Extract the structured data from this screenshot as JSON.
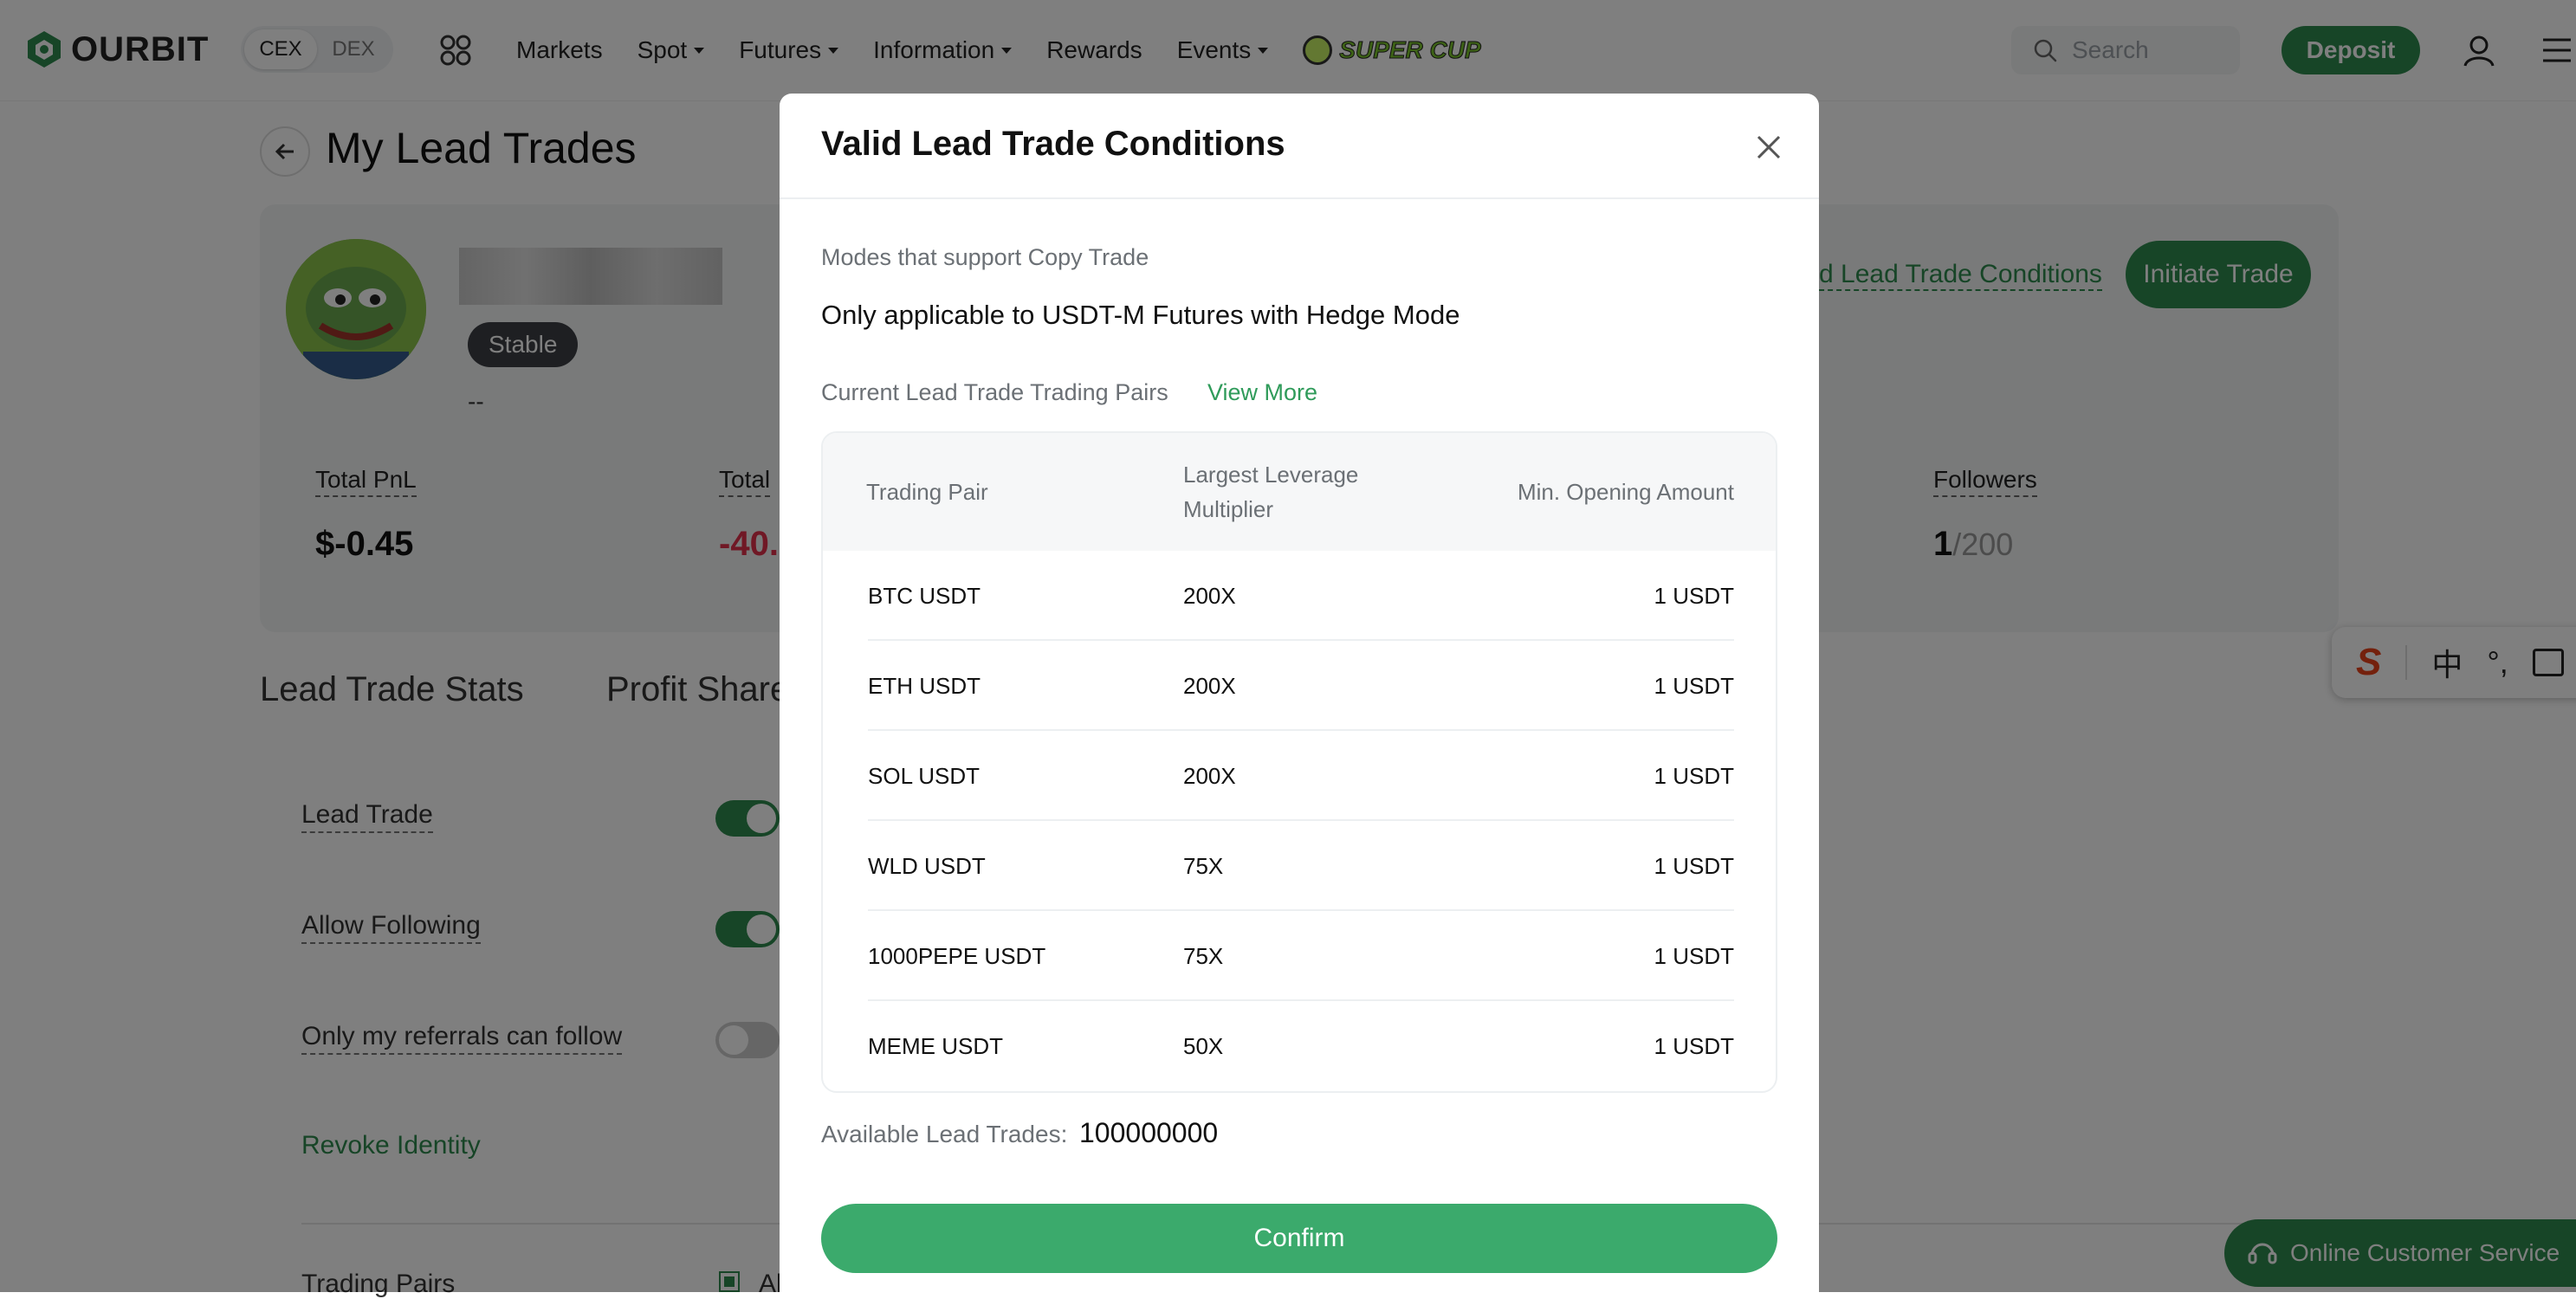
{
  "header": {
    "logo_text": "OURBIT",
    "segments": [
      "CEX",
      "DEX"
    ],
    "nav": [
      {
        "label": "Markets",
        "dropdown": false
      },
      {
        "label": "Spot",
        "dropdown": true
      },
      {
        "label": "Futures",
        "dropdown": true
      },
      {
        "label": "Information",
        "dropdown": true
      },
      {
        "label": "Rewards",
        "dropdown": false
      },
      {
        "label": "Events",
        "dropdown": true
      }
    ],
    "supercup": "SUPER CUP",
    "search_placeholder": "Search",
    "deposit_label": "Deposit"
  },
  "page": {
    "title": "My Lead Trades",
    "profile": {
      "badge": "Stable",
      "bio": "--",
      "conditions_link": "alid Lead Trade Conditions",
      "initiate_label": "Initiate Trade"
    },
    "stats": {
      "total_pnl_label": "Total PnL",
      "total_pnl_value": "$-0.45",
      "total_roi_label": "Total",
      "total_roi_value": "-40.",
      "followers_label": "Followers",
      "followers_value": "1",
      "followers_max": "/200"
    },
    "tabs": [
      "Lead Trade Stats",
      "Profit Share"
    ],
    "settings": [
      {
        "label": "Lead Trade",
        "on": true
      },
      {
        "label": "Allow Following",
        "on": true
      },
      {
        "label": "Only my referrals can follow",
        "on": false
      }
    ],
    "revoke_label": "Revoke Identity",
    "trading_pairs_label": "Trading Pairs",
    "trading_pairs_all": "Al"
  },
  "ime": {
    "logo": "S",
    "lang": "中",
    "punct": "°,"
  },
  "support_label": "Online Customer Service",
  "modal": {
    "title": "Valid Lead Trade Conditions",
    "modes_label": "Modes that support Copy Trade",
    "modes_value": "Only applicable to USDT-M Futures with Hedge Mode",
    "pairs_label": "Current Lead Trade Trading Pairs",
    "view_more": "View More",
    "table_headers": {
      "pair": "Trading Pair",
      "leverage_line1": "Largest Leverage",
      "leverage_line2": "Multiplier",
      "min_amount": "Min. Opening Amount"
    },
    "rows": [
      {
        "pair": "BTC USDT",
        "leverage": "200X",
        "min": "1 USDT"
      },
      {
        "pair": "ETH USDT",
        "leverage": "200X",
        "min": "1 USDT"
      },
      {
        "pair": "SOL USDT",
        "leverage": "200X",
        "min": "1 USDT"
      },
      {
        "pair": "WLD USDT",
        "leverage": "75X",
        "min": "1 USDT"
      },
      {
        "pair": "1000PEPE USDT",
        "leverage": "75X",
        "min": "1 USDT"
      },
      {
        "pair": "MEME USDT",
        "leverage": "50X",
        "min": "1 USDT"
      }
    ],
    "available_label": "Available Lead Trades:",
    "available_value": "100000000",
    "confirm_label": "Confirm"
  },
  "colors": {
    "brand_green": "#2f8a4e",
    "confirm_green": "#3baa6c",
    "link_green": "#2f9b5a",
    "negative_red": "#e0314b"
  }
}
